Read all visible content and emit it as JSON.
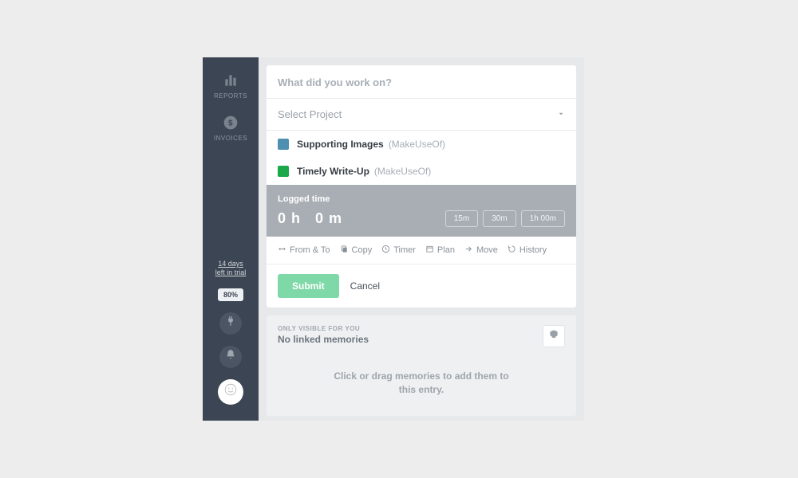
{
  "sidebar": {
    "items": [
      {
        "label": "REPORTS"
      },
      {
        "label": "INVOICES"
      }
    ],
    "trial_line1": "14 days",
    "trial_line2": "left in trial",
    "progress_badge": "80%"
  },
  "entry": {
    "work_placeholder": "What did you work on?",
    "project_select_label": "Select Project",
    "projects": [
      {
        "name": "Supporting Images",
        "client": "(MakeUseOf)",
        "color": "#4f8fb0"
      },
      {
        "name": "Timely Write-Up",
        "client": "(MakeUseOf)",
        "color": "#1aa84b"
      }
    ],
    "logged_label": "Logged time",
    "logged_hours": "0 h",
    "logged_minutes": "0 m",
    "chips": [
      "15m",
      "30m",
      "1h 00m"
    ],
    "actions": [
      {
        "label": "From & To"
      },
      {
        "label": "Copy"
      },
      {
        "label": "Timer"
      },
      {
        "label": "Plan"
      },
      {
        "label": "Move"
      },
      {
        "label": "History"
      }
    ],
    "submit_label": "Submit",
    "cancel_label": "Cancel"
  },
  "memories": {
    "only_label": "ONLY VISIBLE FOR YOU",
    "title": "No linked memories",
    "hint_line1": "Click or drag memories to add them to",
    "hint_line2": "this entry."
  }
}
